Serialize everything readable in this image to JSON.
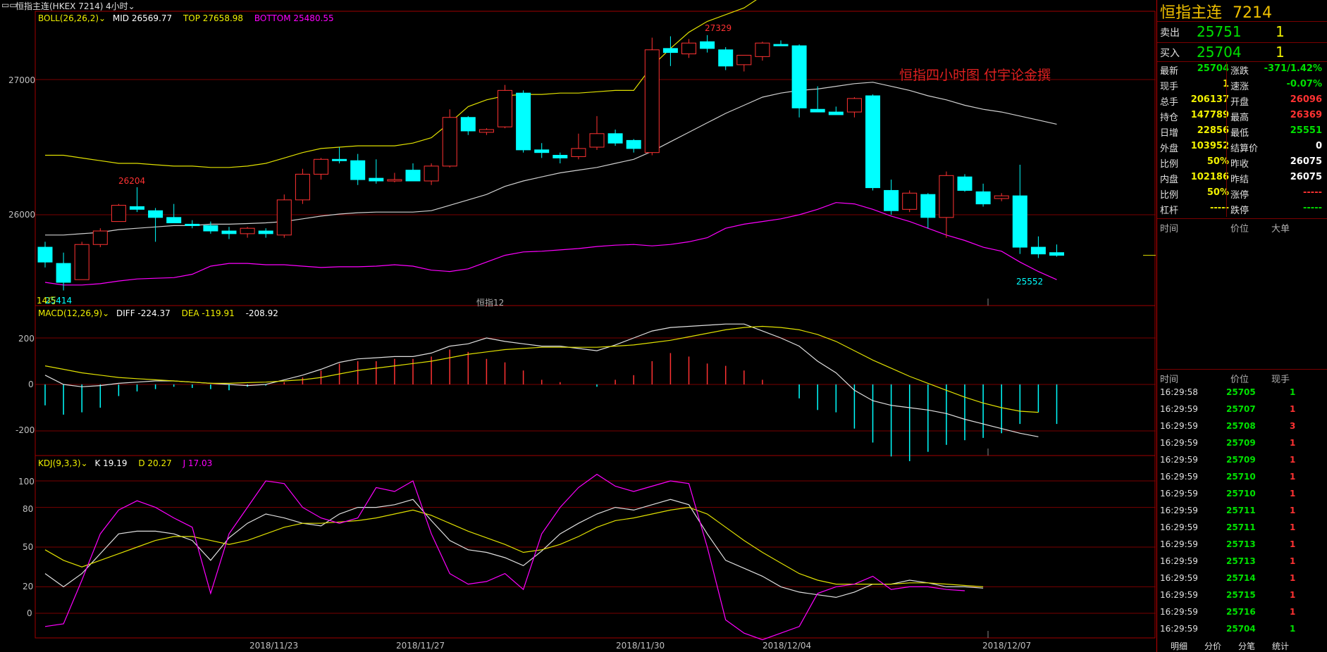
{
  "header": {
    "window_icon": "window-icon",
    "title": "恒指主连(HKEX 7214)",
    "period": "4小时",
    "period_icon": "chevron-down-icon"
  },
  "boll": {
    "label": "BOLL(26,26,2)",
    "mid": "MID 26569.77",
    "top": "TOP 27658.98",
    "bottom": "BOTTOM 25480.55"
  },
  "macd": {
    "label": "MACD(12,26,9)",
    "diff": "DIFF -224.37",
    "dea": "DEA -119.91",
    "macd": "-208.92"
  },
  "kdj": {
    "label": "KDJ(9,3,3)",
    "k": "K 19.19",
    "d": "D 20.27",
    "j": "J 17.03"
  },
  "price_axis": [
    "27000",
    "26000"
  ],
  "macd_axis": [
    "200",
    "0",
    "-200"
  ],
  "kdj_axis": [
    "100",
    "80",
    "50",
    "20",
    "0"
  ],
  "annotations": {
    "high": "27329",
    "low": "25552",
    "local": "26204",
    "left_low": "25414",
    "left_tag": "14巧",
    "series_name": "恒指12",
    "watermark": "恒指四小时图  付宇论金撰"
  },
  "date_axis": [
    "2018/11/23",
    "2018/11/27",
    "2018/11/30",
    "2018/12/04",
    "2018/12/07"
  ],
  "colors": {
    "up": "#ff3232",
    "down": "#00ffff",
    "mid": "#d0d0d0",
    "top": "#e0e000",
    "bottom": "#ff00ff",
    "grid": "#7a0000"
  },
  "chart_data": {
    "type": "candlestick",
    "interval": "4小时",
    "candles": [
      {
        "o": 25760,
        "h": 25800,
        "l": 25610,
        "c": 25650
      },
      {
        "o": 25640,
        "h": 25720,
        "l": 25440,
        "c": 25500
      },
      {
        "o": 25520,
        "h": 25800,
        "l": 25520,
        "c": 25780
      },
      {
        "o": 25780,
        "h": 25900,
        "l": 25760,
        "c": 25880
      },
      {
        "o": 25950,
        "h": 26080,
        "l": 25950,
        "c": 26070
      },
      {
        "o": 26060,
        "h": 26204,
        "l": 26020,
        "c": 26040
      },
      {
        "o": 26030,
        "h": 26050,
        "l": 25800,
        "c": 25980
      },
      {
        "o": 25980,
        "h": 26080,
        "l": 25950,
        "c": 25940
      },
      {
        "o": 25930,
        "h": 25960,
        "l": 25900,
        "c": 25920
      },
      {
        "o": 25920,
        "h": 25950,
        "l": 25860,
        "c": 25880
      },
      {
        "o": 25880,
        "h": 25910,
        "l": 25820,
        "c": 25860
      },
      {
        "o": 25860,
        "h": 25910,
        "l": 25830,
        "c": 25900
      },
      {
        "o": 25880,
        "h": 25900,
        "l": 25830,
        "c": 25860
      },
      {
        "o": 25850,
        "h": 26150,
        "l": 25830,
        "c": 26110
      },
      {
        "o": 26110,
        "h": 26340,
        "l": 26080,
        "c": 26300
      },
      {
        "o": 26300,
        "h": 26420,
        "l": 26260,
        "c": 26410
      },
      {
        "o": 26410,
        "h": 26500,
        "l": 26380,
        "c": 26400
      },
      {
        "o": 26400,
        "h": 26450,
        "l": 26220,
        "c": 26260
      },
      {
        "o": 26270,
        "h": 26410,
        "l": 26230,
        "c": 26250
      },
      {
        "o": 26250,
        "h": 26310,
        "l": 26240,
        "c": 26260
      },
      {
        "o": 26330,
        "h": 26380,
        "l": 26250,
        "c": 26250
      },
      {
        "o": 26250,
        "h": 26380,
        "l": 26220,
        "c": 26360
      },
      {
        "o": 26360,
        "h": 26780,
        "l": 26350,
        "c": 26720
      },
      {
        "o": 26720,
        "h": 26730,
        "l": 26590,
        "c": 26620
      },
      {
        "o": 26610,
        "h": 26640,
        "l": 26590,
        "c": 26630
      },
      {
        "o": 26650,
        "h": 26960,
        "l": 26640,
        "c": 26920
      },
      {
        "o": 26900,
        "h": 26920,
        "l": 26460,
        "c": 26480
      },
      {
        "o": 26480,
        "h": 26530,
        "l": 26420,
        "c": 26460
      },
      {
        "o": 26440,
        "h": 26460,
        "l": 26380,
        "c": 26420
      },
      {
        "o": 26430,
        "h": 26600,
        "l": 26410,
        "c": 26490
      },
      {
        "o": 26500,
        "h": 26730,
        "l": 26480,
        "c": 26600
      },
      {
        "o": 26600,
        "h": 26630,
        "l": 26510,
        "c": 26530
      },
      {
        "o": 26550,
        "h": 26560,
        "l": 26460,
        "c": 26490
      },
      {
        "o": 26460,
        "h": 27310,
        "l": 26440,
        "c": 27220
      },
      {
        "o": 27230,
        "h": 27320,
        "l": 27100,
        "c": 27200
      },
      {
        "o": 27190,
        "h": 27300,
        "l": 27160,
        "c": 27270
      },
      {
        "o": 27280,
        "h": 27329,
        "l": 27200,
        "c": 27230
      },
      {
        "o": 27220,
        "h": 27240,
        "l": 27070,
        "c": 27100
      },
      {
        "o": 27110,
        "h": 27180,
        "l": 27060,
        "c": 27180
      },
      {
        "o": 27170,
        "h": 27280,
        "l": 27140,
        "c": 27270
      },
      {
        "o": 27260,
        "h": 27290,
        "l": 27250,
        "c": 27250
      },
      {
        "o": 27250,
        "h": 27260,
        "l": 26720,
        "c": 26790
      },
      {
        "o": 26780,
        "h": 26950,
        "l": 26760,
        "c": 26760
      },
      {
        "o": 26760,
        "h": 26800,
        "l": 26740,
        "c": 26740
      },
      {
        "o": 26760,
        "h": 26870,
        "l": 26720,
        "c": 26860
      },
      {
        "o": 26880,
        "h": 26890,
        "l": 26180,
        "c": 26200
      },
      {
        "o": 26180,
        "h": 26260,
        "l": 26000,
        "c": 26030
      },
      {
        "o": 26040,
        "h": 26180,
        "l": 26020,
        "c": 26160
      },
      {
        "o": 26150,
        "h": 26160,
        "l": 25900,
        "c": 25980
      },
      {
        "o": 25980,
        "h": 26320,
        "l": 25830,
        "c": 26290
      },
      {
        "o": 26280,
        "h": 26300,
        "l": 26170,
        "c": 26180
      },
      {
        "o": 26170,
        "h": 26230,
        "l": 26060,
        "c": 26080
      },
      {
        "o": 26120,
        "h": 26160,
        "l": 26100,
        "c": 26140
      },
      {
        "o": 26140,
        "h": 26370,
        "l": 25710,
        "c": 25760
      },
      {
        "o": 25760,
        "h": 25840,
        "l": 25680,
        "c": 25710
      },
      {
        "o": 25720,
        "h": 25780,
        "l": 25690,
        "c": 25700
      }
    ],
    "boll_mid": [
      25850,
      25850,
      25860,
      25870,
      25890,
      25900,
      25910,
      25920,
      25920,
      25930,
      25930,
      25935,
      25940,
      25950,
      25970,
      25990,
      26005,
      26015,
      26020,
      26020,
      26020,
      26030,
      26070,
      26110,
      26150,
      26210,
      26250,
      26280,
      26310,
      26330,
      26350,
      26380,
      26410,
      26470,
      26540,
      26610,
      26680,
      26750,
      26810,
      26870,
      26900,
      26920,
      26930,
      26950,
      26970,
      26980,
      26950,
      26920,
      26880,
      26850,
      26810,
      26780,
      26760,
      26730,
      26700,
      26670
    ],
    "boll_top": [
      26440,
      26440,
      26420,
      26400,
      26380,
      26380,
      26370,
      26360,
      26360,
      26350,
      26350,
      26360,
      26380,
      26420,
      26460,
      26490,
      26500,
      26510,
      26510,
      26510,
      26530,
      26570,
      26680,
      26800,
      26850,
      26880,
      26890,
      26890,
      26900,
      26900,
      26910,
      26920,
      26920,
      27100,
      27230,
      27350,
      27430,
      27480,
      27530,
      27620,
      27700
    ],
    "boll_bottom": [
      25500,
      25480,
      25480,
      25490,
      25510,
      25525,
      25530,
      25535,
      25560,
      25620,
      25640,
      25640,
      25630,
      25630,
      25620,
      25610,
      25615,
      25615,
      25620,
      25630,
      25620,
      25590,
      25580,
      25600,
      25650,
      25700,
      25725,
      25730,
      25740,
      25750,
      25765,
      25775,
      25780,
      25770,
      25780,
      25800,
      25830,
      25900,
      25930,
      25950,
      25970,
      26000,
      26040,
      26090,
      26080,
      26040,
      25990,
      25950,
      25900,
      25850,
      25810,
      25760,
      25730,
      25650,
      25580,
      25520
    ],
    "macd_hist": [
      -90,
      -130,
      -120,
      -100,
      -50,
      -30,
      -20,
      -10,
      -15,
      -20,
      -25,
      -10,
      -5,
      10,
      30,
      60,
      90,
      100,
      100,
      110,
      110,
      120,
      150,
      140,
      110,
      95,
      60,
      20,
      10,
      0,
      -10,
      20,
      40,
      100,
      135,
      120,
      90,
      80,
      60,
      20,
      0,
      -60,
      -110,
      -120,
      -190,
      -250,
      -310,
      -330,
      -290,
      -260,
      -240,
      -230,
      -210,
      -170,
      -120,
      -170
    ],
    "macd_diff": [
      40,
      0,
      -10,
      -5,
      5,
      10,
      15,
      15,
      10,
      5,
      0,
      -5,
      0,
      20,
      40,
      65,
      95,
      110,
      115,
      120,
      120,
      135,
      165,
      175,
      200,
      185,
      175,
      165,
      165,
      155,
      145,
      170,
      200,
      230,
      245,
      250,
      255,
      260,
      260,
      230,
      200,
      165,
      100,
      50,
      -25,
      -70,
      -90,
      -100,
      -110,
      -125,
      -150,
      -170,
      -190,
      -210,
      -225
    ],
    "macd_dea": [
      80,
      65,
      50,
      40,
      30,
      25,
      20,
      15,
      10,
      5,
      5,
      8,
      10,
      15,
      20,
      30,
      45,
      60,
      70,
      80,
      90,
      100,
      115,
      130,
      140,
      150,
      155,
      160,
      160,
      160,
      160,
      165,
      170,
      180,
      190,
      205,
      220,
      235,
      245,
      250,
      245,
      235,
      215,
      185,
      145,
      105,
      70,
      35,
      5,
      -25,
      -55,
      -80,
      -100,
      -115,
      -120
    ],
    "kdj_k": [
      30,
      20,
      30,
      45,
      60,
      62,
      62,
      60,
      55,
      40,
      57,
      68,
      75,
      72,
      68,
      66,
      75,
      80,
      80,
      82,
      86,
      70,
      55,
      48,
      46,
      42,
      36,
      47,
      60,
      68,
      75,
      80,
      78,
      82,
      86,
      82,
      60,
      40,
      34,
      28,
      20,
      16,
      14,
      12,
      16,
      22,
      22,
      25,
      23,
      20,
      20,
      19
    ],
    "kdj_d": [
      48,
      40,
      35,
      40,
      45,
      50,
      55,
      58,
      58,
      55,
      52,
      55,
      60,
      65,
      68,
      68,
      69,
      70,
      72,
      75,
      78,
      74,
      68,
      62,
      57,
      52,
      46,
      48,
      52,
      58,
      65,
      70,
      72,
      75,
      78,
      80,
      75,
      65,
      55,
      46,
      38,
      30,
      25,
      22,
      22,
      22,
      22,
      23,
      23,
      22,
      21,
      20
    ],
    "kdj_j": [
      -10,
      -8,
      25,
      60,
      78,
      85,
      80,
      72,
      65,
      15,
      60,
      80,
      100,
      98,
      80,
      72,
      68,
      72,
      95,
      92,
      100,
      60,
      30,
      22,
      24,
      30,
      18,
      60,
      80,
      95,
      105,
      96,
      92,
      96,
      100,
      98,
      50,
      -5,
      -15,
      -20,
      -15,
      -10,
      15,
      20,
      22,
      28,
      18,
      20,
      20,
      18,
      17
    ]
  },
  "right_panel": {
    "title": "恒指主连",
    "code": "7214",
    "sell_label": "卖出",
    "sell_price": "25751",
    "sell_qty": "1",
    "buy_label": "买入",
    "buy_price": "25704",
    "buy_qty": "1",
    "stats": [
      {
        "l1": "最新",
        "v1": "25704",
        "c1": "green",
        "l2": "涨跌",
        "v2": "-371/1.42%",
        "c2": "green"
      },
      {
        "l1": "现手",
        "v1": "1",
        "c1": "yellow",
        "l2": "速涨",
        "v2": "-0.07%",
        "c2": "green"
      },
      {
        "l1": "总手",
        "v1": "206137",
        "c1": "yellow",
        "l2": "开盘",
        "v2": "26096",
        "c2": "red"
      },
      {
        "l1": "持仓",
        "v1": "147789",
        "c1": "yellow",
        "l2": "最高",
        "v2": "26369",
        "c2": "red"
      },
      {
        "l1": "日增",
        "v1": "22856",
        "c1": "yellow",
        "l2": "最低",
        "v2": "25551",
        "c2": "green"
      },
      {
        "l1": "外盘",
        "v1": "103952",
        "c1": "yellow",
        "l2": "结算价",
        "v2": "0",
        "c2": "white"
      },
      {
        "l1": "比例",
        "v1": "50%",
        "c1": "yellow",
        "l2": "昨收",
        "v2": "26075",
        "c2": "white"
      },
      {
        "l1": "内盘",
        "v1": "102186",
        "c1": "yellow",
        "l2": "昨结",
        "v2": "26075",
        "c2": "white"
      },
      {
        "l1": "比例",
        "v1": "50%",
        "c1": "yellow",
        "l2": "涨停",
        "v2": "-----",
        "c2": "red"
      },
      {
        "l1": "杠杆",
        "v1": "-----",
        "c1": "yellow",
        "l2": "跌停",
        "v2": "-----",
        "c2": "green"
      }
    ],
    "big_header": {
      "time": "时间",
      "price": "价位",
      "big": "大单"
    },
    "tick_header": {
      "time": "时间",
      "price": "价位",
      "qty": "现手"
    },
    "ticks": [
      {
        "t": "16:29:58",
        "p": "25705",
        "q": "1",
        "qc": "green"
      },
      {
        "t": "16:29:59",
        "p": "25707",
        "q": "1",
        "qc": "red"
      },
      {
        "t": "16:29:59",
        "p": "25708",
        "q": "3",
        "qc": "red"
      },
      {
        "t": "16:29:59",
        "p": "25709",
        "q": "1",
        "qc": "red"
      },
      {
        "t": "16:29:59",
        "p": "25709",
        "q": "1",
        "qc": "red"
      },
      {
        "t": "16:29:59",
        "p": "25710",
        "q": "1",
        "qc": "red"
      },
      {
        "t": "16:29:59",
        "p": "25710",
        "q": "1",
        "qc": "red"
      },
      {
        "t": "16:29:59",
        "p": "25711",
        "q": "1",
        "qc": "red"
      },
      {
        "t": "16:29:59",
        "p": "25711",
        "q": "1",
        "qc": "red"
      },
      {
        "t": "16:29:59",
        "p": "25713",
        "q": "1",
        "qc": "red"
      },
      {
        "t": "16:29:59",
        "p": "25713",
        "q": "1",
        "qc": "red"
      },
      {
        "t": "16:29:59",
        "p": "25714",
        "q": "1",
        "qc": "red"
      },
      {
        "t": "16:29:59",
        "p": "25715",
        "q": "1",
        "qc": "red"
      },
      {
        "t": "16:29:59",
        "p": "25716",
        "q": "1",
        "qc": "red"
      },
      {
        "t": "16:29:59",
        "p": "25704",
        "q": "1",
        "qc": "green"
      }
    ],
    "tabs": [
      "明细",
      "分价",
      "分笔",
      "统计"
    ]
  }
}
